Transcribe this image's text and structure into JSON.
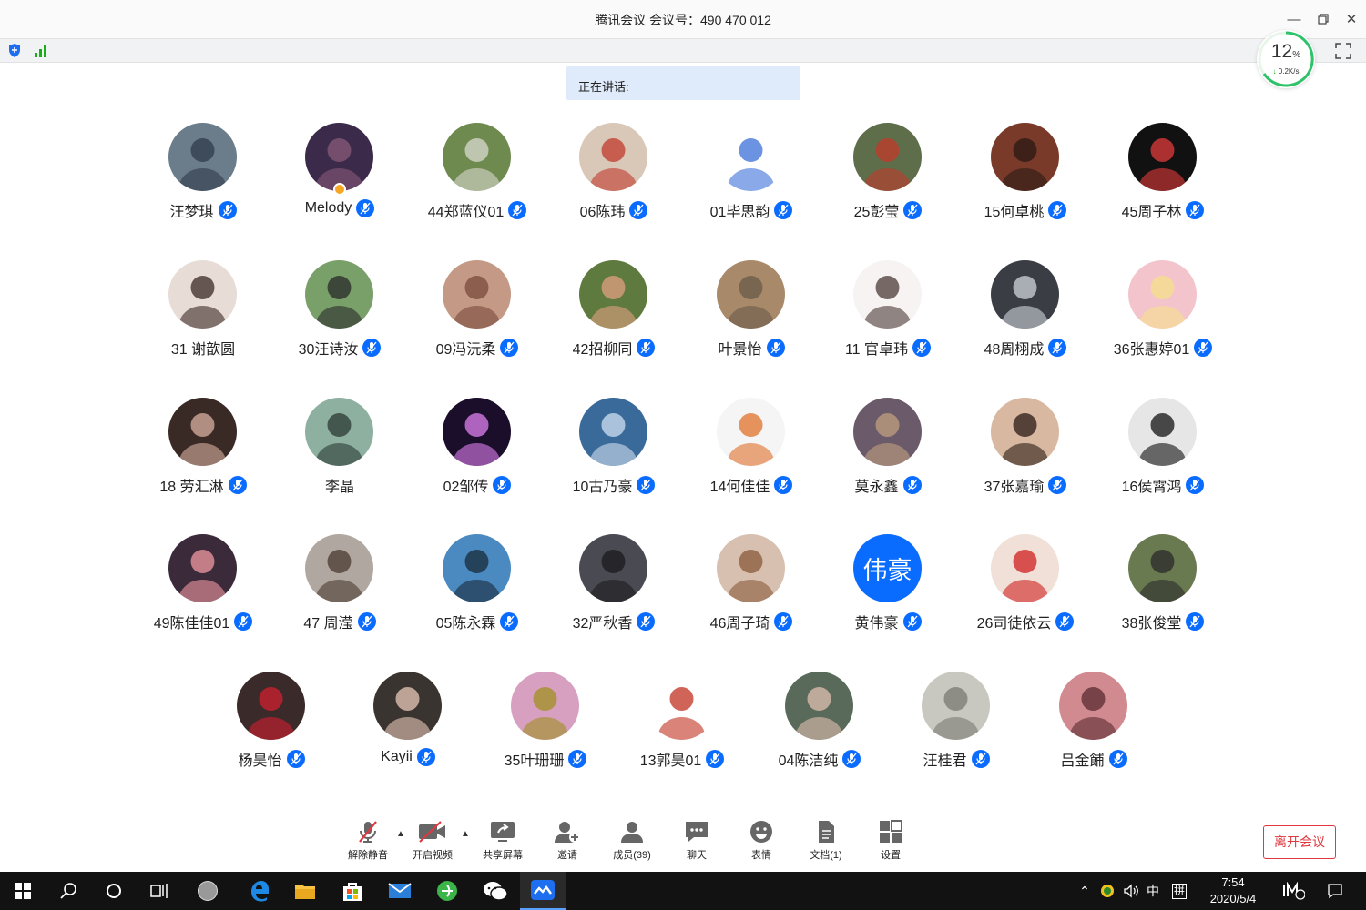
{
  "window": {
    "title": "腾讯会议 会议号：490 470 012",
    "minimize_icon": "minimize-icon",
    "restore_icon": "restore-icon",
    "close_icon": "close-icon"
  },
  "network": {
    "cpu_percent": "12",
    "percent_sign": "%",
    "speed": "0.2K/s"
  },
  "speaking_label": "正在讲话:",
  "participants": [
    {
      "name": "汪梦琪",
      "mic": true,
      "bg": "#6b7c8a",
      "fg": "#2d3b4a"
    },
    {
      "name": "Melody",
      "mic": true,
      "host": true,
      "bg": "#3b2a4a",
      "fg": "#8a5a7a"
    },
    {
      "name": "44郑蓝仪01",
      "mic": true,
      "bg": "#6f8a4e",
      "fg": "#d9d9d0"
    },
    {
      "name": "06陈玮",
      "mic": true,
      "bg": "#d9c7b8",
      "fg": "#c0392b"
    },
    {
      "name": "01毕思韵",
      "mic": true,
      "bg": "#ffffff",
      "fg": "#3a6fd8"
    },
    {
      "name": "25彭莹",
      "mic": true,
      "bg": "#5f6e4a",
      "fg": "#c0392b"
    },
    {
      "name": "15何卓桃",
      "mic": true,
      "bg": "#7a3a2a",
      "fg": "#2a1a14"
    },
    {
      "name": "45周子林",
      "mic": true,
      "bg": "#111111",
      "fg": "#e23b3b"
    },
    {
      "name": "31  谢歆圆",
      "mic": false,
      "bg": "#e8dcd6",
      "fg": "#3a2a26"
    },
    {
      "name": "30汪诗汝",
      "mic": true,
      "bg": "#7aa06a",
      "fg": "#2a2a2a"
    },
    {
      "name": "09冯沅柔",
      "mic": true,
      "bg": "#c49a86",
      "fg": "#7a4a3a"
    },
    {
      "name": "42招柳同",
      "mic": true,
      "bg": "#5e7a3e",
      "fg": "#e0a080"
    },
    {
      "name": "叶景怡",
      "mic": true,
      "bg": "#a88a6a",
      "fg": "#6a5a4a"
    },
    {
      "name": "11 官卓玮",
      "mic": true,
      "bg": "#f8f3f3",
      "fg": "#4a3a36"
    },
    {
      "name": "48周栩成",
      "mic": true,
      "bg": "#3a3e44",
      "fg": "#cfd4da"
    },
    {
      "name": "36张惠婷01",
      "mic": true,
      "bg": "#f3c4cc",
      "fg": "#f6e08a"
    },
    {
      "name": "18 劳汇淋",
      "mic": true,
      "bg": "#3a2a26",
      "fg": "#d8b0a0"
    },
    {
      "name": "李晶",
      "mic": false,
      "bg": "#8eb0a0",
      "fg": "#2a3a34"
    },
    {
      "name": "02邹传",
      "mic": true,
      "bg": "#1a0e2a",
      "fg": "#e080f0"
    },
    {
      "name": "10古乃豪",
      "mic": true,
      "bg": "#3a6a9a",
      "fg": "#d0e0f0"
    },
    {
      "name": "14何佳佳",
      "mic": true,
      "bg": "#f5f5f5",
      "fg": "#e0702a"
    },
    {
      "name": "莫永鑫",
      "mic": true,
      "bg": "#6a5a6a",
      "fg": "#c0a080"
    },
    {
      "name": "37张嘉瑜",
      "mic": true,
      "bg": "#d8b8a0",
      "fg": "#2a1a14"
    },
    {
      "name": "16侯霄鸿",
      "mic": true,
      "bg": "#e6e6e6",
      "fg": "#111111"
    },
    {
      "name": "49陈佳佳01",
      "mic": true,
      "bg": "#3a2a3a",
      "fg": "#f09aa0"
    },
    {
      "name": "47 周滢",
      "mic": true,
      "bg": "#b0a8a0",
      "fg": "#4a3a30"
    },
    {
      "name": "05陈永霖",
      "mic": true,
      "bg": "#4a8ac0",
      "fg": "#1a2a3a"
    },
    {
      "name": "32严秋香",
      "mic": true,
      "bg": "#4a4a52",
      "fg": "#1a1a1e"
    },
    {
      "name": "46周子琦",
      "mic": true,
      "bg": "#d8c0b0",
      "fg": "#8a5a3a"
    },
    {
      "name": "黄伟豪",
      "mic": true,
      "text_avatar": "伟豪"
    },
    {
      "name": "26司徒依云",
      "mic": true,
      "bg": "#f0e0d8",
      "fg": "#d02020"
    },
    {
      "name": "38张俊堂",
      "mic": true,
      "bg": "#6a7a50",
      "fg": "#2a2a2a"
    },
    {
      "name": "杨昊怡",
      "mic": true,
      "bg": "#3a2a2a",
      "fg": "#d02030"
    },
    {
      "name": "Kayii",
      "mic": true,
      "bg": "#3a3430",
      "fg": "#e8c8b8"
    },
    {
      "name": "35叶珊珊",
      "mic": true,
      "bg": "#d8a0c0",
      "fg": "#a09020"
    },
    {
      "name": "13郭昊01",
      "mic": true,
      "bg": "#ffffff",
      "fg": "#c03020"
    },
    {
      "name": "04陈洁纯",
      "mic": true,
      "bg": "#5a6a5a",
      "fg": "#e0c0b0"
    },
    {
      "name": "汪桂君",
      "mic": true,
      "bg": "#c8c8c0",
      "fg": "#7a7a72"
    },
    {
      "name": "吕金餔",
      "mic": true,
      "bg": "#d08a90",
      "fg": "#5a2a30"
    }
  ],
  "controls": {
    "unmute": "解除静音",
    "start_video": "开启视频",
    "share_screen": "共享屏幕",
    "invite": "邀请",
    "members": "成员(39)",
    "chat": "聊天",
    "emoji": "表情",
    "docs": "文档(1)",
    "settings": "设置",
    "leave": "离开会议"
  },
  "taskbar": {
    "ime_lang": "中",
    "ime_mode": "拼",
    "time": "7:54",
    "date": "2020/5/4"
  },
  "colors": {
    "accent": "#0a6cff",
    "leave": "#e0383e",
    "speaking_bg": "#dfeafb",
    "taskbar": "#121212"
  }
}
